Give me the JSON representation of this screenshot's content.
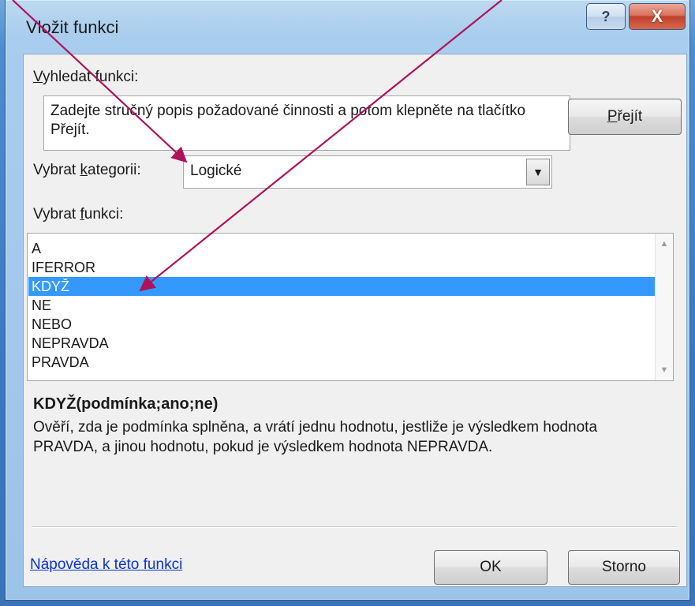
{
  "window": {
    "title": "Vložit funkci",
    "help_glyph": "?",
    "close_glyph": "X"
  },
  "search": {
    "label_prefix": "",
    "label_accel": "V",
    "label_rest": "yhledat funkci:",
    "text": "Zadejte stručný popis požadované činnosti a potom klepněte na tlačítko Přejít.",
    "go_button_accel": "P",
    "go_button_rest": "řejít"
  },
  "category": {
    "label_prefix": "Vybrat ",
    "label_accel": "k",
    "label_rest": "ategorii:",
    "value": "Logické",
    "arrow_glyph": "▼"
  },
  "function_list": {
    "label_prefix": "Vybrat ",
    "label_accel": "f",
    "label_rest": "unkci:",
    "items": [
      "A",
      "IFERROR",
      "KDYŽ",
      "NE",
      "NEBO",
      "NEPRAVDA",
      "PRAVDA"
    ],
    "selected_index": 2,
    "scroll_up_glyph": "▲",
    "scroll_down_glyph": "▼"
  },
  "details": {
    "syntax": "KDYŽ(podmínka;ano;ne)",
    "description": "Ověří, zda je podmínka splněna, a vrátí jednu hodnotu, jestliže je výsledkem hodnota PRAVDA, a jinou hodnotu, pokud je výsledkem hodnota NEPRAVDA."
  },
  "footer": {
    "help_link": "Nápověda k této funkci",
    "ok_label": "OK",
    "cancel_label": "Storno"
  },
  "colors": {
    "selection": "#3399ff",
    "link": "#0b33d6",
    "annotation_arrow": "#b0125a"
  },
  "icons": [
    "help-icon",
    "close-icon",
    "dropdown-arrow-icon",
    "scroll-up-icon",
    "scroll-down-icon"
  ]
}
